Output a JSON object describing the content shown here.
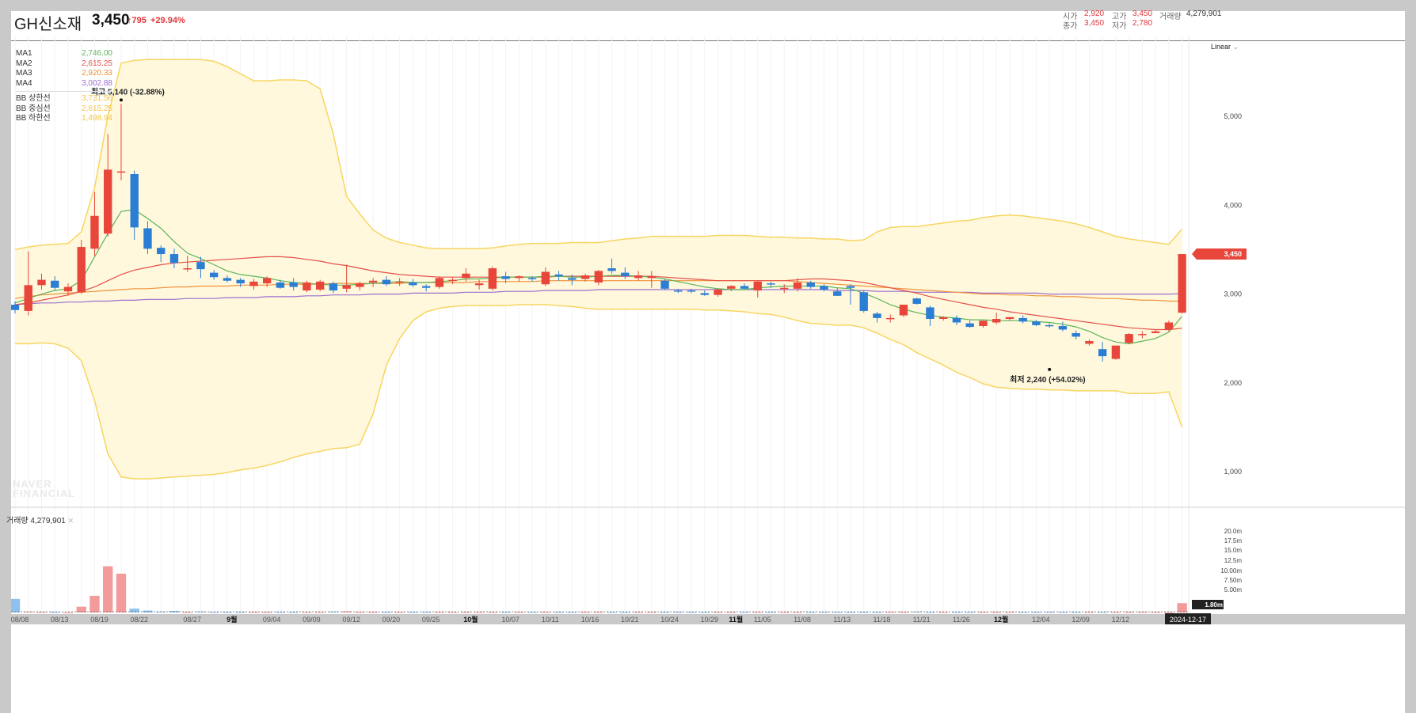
{
  "header": {
    "stock_name": "GH신소재",
    "price": "3,450",
    "change": "795",
    "change_rate": "+29.94%",
    "open_label": "시가",
    "open_value": "2,920",
    "high_label": "고가",
    "high_value": "3,450",
    "volume_label": "거래량",
    "volume_value": "4,279,901",
    "close_label": "종가",
    "close_value": "3,450",
    "low_label": "저가",
    "low_value": "2,780"
  },
  "legend": [
    {
      "label": "MA1",
      "value": "2,746.00",
      "color": "#5bb55b"
    },
    {
      "label": "MA2",
      "value": "2,615.25",
      "color": "#e4504a"
    },
    {
      "label": "MA3",
      "value": "2,920.33",
      "color": "#f0923a"
    },
    {
      "label": "MA4",
      "value": "3,002.88",
      "color": "#9b6fcf"
    },
    {
      "label": "BB 상한선",
      "value": "3,731.56",
      "color": "#f5c542"
    },
    {
      "label": "BB 중심선",
      "value": "2,615.25",
      "color": "#f5c542"
    },
    {
      "label": "BB 하한선",
      "value": "1,498.94",
      "color": "#f5c542"
    }
  ],
  "scale_mode": "Linear",
  "volume_panel_label": "거래량 4,279,901",
  "watermark": "NAVER FINANCIAL",
  "colors": {
    "up": "#e8463b",
    "down": "#2b7ed3",
    "band_fill": "#fff8dc",
    "band_line": "#f7d562",
    "price_tag": "#e8463b"
  },
  "chart_data": {
    "type": "candlestick",
    "x_ticks": [
      "08/08",
      "08/13",
      "08/19",
      "08/22",
      "08/27",
      "9월",
      "09/04",
      "09/09",
      "09/12",
      "09/20",
      "09/25",
      "10월",
      "10/07",
      "10/11",
      "10/16",
      "10/21",
      "10/24",
      "10/29",
      "11월",
      "11/05",
      "11/08",
      "11/13",
      "11/18",
      "11/21",
      "11/26",
      "12월",
      "12/04",
      "12/09",
      "12/12"
    ],
    "x_bold_ticks": [
      "9월",
      "10월",
      "11월",
      "12월"
    ],
    "current_date": "2024-12-17",
    "price_axis_ticks": [
      1000,
      2000,
      3000,
      4000,
      5000
    ],
    "price_axis_labels": [
      "1,000",
      "2,000",
      "3,000",
      "4,000",
      "5,000"
    ],
    "price_range": [
      600,
      5900
    ],
    "last_price_tag": "3,450",
    "volume_axis_labels": [
      "20.0m",
      "17.5m",
      "15.0m",
      "12.5m",
      "10.00m",
      "7.50m",
      "5.00m",
      "1.80m"
    ],
    "volume_range": [
      0,
      22000000
    ],
    "annotations": [
      {
        "text": "최고 5,140 (-32.88%)",
        "index": 8,
        "value": 5140
      },
      {
        "text": "최저 2,240 (+54.02%)",
        "index": 78,
        "value": 2240
      }
    ],
    "candles": [
      [
        2880,
        2920,
        2780,
        2820
      ],
      [
        2810,
        3480,
        2760,
        3100
      ],
      [
        3100,
        3230,
        3050,
        3160
      ],
      [
        3150,
        3200,
        3040,
        3070
      ],
      [
        3030,
        3120,
        2980,
        3080
      ],
      [
        3020,
        3610,
        3000,
        3530
      ],
      [
        3510,
        4150,
        3430,
        3880
      ],
      [
        3680,
        4800,
        3650,
        4400
      ],
      [
        4380,
        5140,
        4280,
        4380
      ],
      [
        4350,
        4390,
        3610,
        3750
      ],
      [
        3740,
        3820,
        3450,
        3510
      ],
      [
        3520,
        3550,
        3360,
        3450
      ],
      [
        3450,
        3510,
        3290,
        3350
      ],
      [
        3280,
        3430,
        3250,
        3290
      ],
      [
        3360,
        3420,
        3180,
        3280
      ],
      [
        3240,
        3270,
        3160,
        3190
      ],
      [
        3180,
        3210,
        3130,
        3150
      ],
      [
        3160,
        3180,
        3080,
        3120
      ],
      [
        3090,
        3170,
        3050,
        3140
      ],
      [
        3120,
        3200,
        3080,
        3180
      ],
      [
        3130,
        3160,
        3060,
        3070
      ],
      [
        3130,
        3180,
        3040,
        3080
      ],
      [
        3040,
        3150,
        3020,
        3130
      ],
      [
        3050,
        3160,
        3030,
        3140
      ],
      [
        3120,
        3140,
        3010,
        3040
      ],
      [
        3060,
        3330,
        3020,
        3100
      ],
      [
        3080,
        3140,
        3040,
        3120
      ],
      [
        3130,
        3180,
        3080,
        3150
      ],
      [
        3160,
        3200,
        3090,
        3110
      ],
      [
        3130,
        3180,
        3090,
        3140
      ],
      [
        3130,
        3170,
        3080,
        3100
      ],
      [
        3090,
        3110,
        3030,
        3070
      ],
      [
        3080,
        3200,
        3060,
        3180
      ],
      [
        3150,
        3190,
        3110,
        3160
      ],
      [
        3180,
        3290,
        3140,
        3230
      ],
      [
        3100,
        3160,
        3050,
        3120
      ],
      [
        3060,
        3310,
        3040,
        3290
      ],
      [
        3200,
        3250,
        3120,
        3170
      ],
      [
        3180,
        3210,
        3140,
        3200
      ],
      [
        3180,
        3200,
        3140,
        3170
      ],
      [
        3110,
        3300,
        3090,
        3250
      ],
      [
        3220,
        3260,
        3150,
        3200
      ],
      [
        3180,
        3220,
        3100,
        3160
      ],
      [
        3170,
        3230,
        3140,
        3210
      ],
      [
        3130,
        3270,
        3100,
        3260
      ],
      [
        3290,
        3400,
        3230,
        3260
      ],
      [
        3240,
        3300,
        3170,
        3200
      ],
      [
        3180,
        3260,
        3150,
        3210
      ],
      [
        3180,
        3260,
        3070,
        3200
      ],
      [
        3150,
        3170,
        3050,
        3060
      ],
      [
        3040,
        3060,
        3010,
        3030
      ],
      [
        3040,
        3060,
        3010,
        3030
      ],
      [
        3010,
        3040,
        2980,
        2990
      ],
      [
        2990,
        3060,
        2970,
        3050
      ],
      [
        3060,
        3100,
        3030,
        3090
      ],
      [
        3090,
        3120,
        3050,
        3060
      ],
      [
        3040,
        3150,
        2960,
        3140
      ],
      [
        3120,
        3140,
        3070,
        3110
      ],
      [
        3060,
        3110,
        3010,
        3070
      ],
      [
        3060,
        3180,
        3030,
        3130
      ],
      [
        3130,
        3150,
        3060,
        3080
      ],
      [
        3090,
        3110,
        3030,
        3050
      ],
      [
        3030,
        3070,
        2980,
        2980
      ],
      [
        3090,
        3110,
        2880,
        3070
      ],
      [
        3020,
        3040,
        2790,
        2810
      ],
      [
        2780,
        2800,
        2680,
        2730
      ],
      [
        2720,
        2770,
        2680,
        2730
      ],
      [
        2760,
        2880,
        2740,
        2880
      ],
      [
        2950,
        2960,
        2880,
        2890
      ],
      [
        2850,
        2870,
        2640,
        2720
      ],
      [
        2720,
        2750,
        2700,
        2740
      ],
      [
        2730,
        2760,
        2650,
        2680
      ],
      [
        2670,
        2700,
        2620,
        2630
      ],
      [
        2640,
        2700,
        2620,
        2700
      ],
      [
        2680,
        2790,
        2660,
        2720
      ],
      [
        2720,
        2740,
        2700,
        2740
      ],
      [
        2730,
        2760,
        2670,
        2690
      ],
      [
        2690,
        2710,
        2640,
        2650
      ],
      [
        2650,
        2670,
        2620,
        2640
      ],
      [
        2640,
        2690,
        2580,
        2600
      ],
      [
        2560,
        2590,
        2490,
        2520
      ],
      [
        2440,
        2490,
        2420,
        2470
      ],
      [
        2380,
        2460,
        2240,
        2300
      ],
      [
        2270,
        2420,
        2260,
        2420
      ],
      [
        2450,
        2560,
        2440,
        2550
      ],
      [
        2540,
        2580,
        2500,
        2550
      ],
      [
        2560,
        2600,
        2560,
        2580
      ],
      [
        2600,
        2700,
        2580,
        2680
      ],
      [
        2790,
        3450,
        2780,
        3450
      ]
    ],
    "volumes": [
      3.5,
      0.2,
      0.1,
      0.1,
      0.0,
      1.5,
      4.3,
      11.9,
      10.0,
      1.0,
      0.5,
      0.2,
      0.4,
      0.1,
      0.2,
      0.1,
      0.1,
      0.1,
      0.1,
      0.1,
      0.1,
      0.1,
      0.1,
      0.1,
      0.2,
      0.3,
      0.1,
      0.1,
      0.1,
      0.1,
      0.1,
      0.1,
      0.1,
      0.1,
      0.1,
      0.1,
      0.1,
      0.1,
      0.1,
      0.1,
      0.1,
      0.1,
      0.1,
      0.1,
      0.1,
      0.1,
      0.1,
      0.1,
      0.1,
      0.1,
      0.1,
      0.1,
      0.1,
      0.1,
      0.1,
      0.1,
      0.1,
      0.1,
      0.1,
      0.1,
      0.1,
      0.1,
      0.1,
      0.1,
      0.1,
      0.1,
      0.1,
      0.1,
      0.2,
      0.1,
      0.1,
      0.1,
      0.1,
      0.1,
      0.1,
      0.1,
      0.1,
      0.1,
      0.1,
      0.1,
      0.1,
      0.1,
      0.1,
      0.1,
      0.1,
      0.1,
      0.1,
      0.1,
      2.4
    ],
    "ma1": [
      2900,
      2950,
      3000,
      3040,
      3060,
      3150,
      3420,
      3680,
      3930,
      3950,
      3850,
      3740,
      3590,
      3460,
      3400,
      3330,
      3260,
      3220,
      3200,
      3180,
      3150,
      3130,
      3120,
      3110,
      3100,
      3100,
      3110,
      3120,
      3130,
      3140,
      3130,
      3130,
      3140,
      3150,
      3170,
      3170,
      3180,
      3190,
      3190,
      3190,
      3200,
      3200,
      3190,
      3190,
      3200,
      3210,
      3210,
      3200,
      3190,
      3170,
      3140,
      3110,
      3080,
      3060,
      3050,
      3050,
      3070,
      3080,
      3090,
      3090,
      3090,
      3090,
      3070,
      3060,
      3010,
      2950,
      2880,
      2830,
      2790,
      2760,
      2740,
      2730,
      2710,
      2710,
      2700,
      2700,
      2700,
      2690,
      2680,
      2660,
      2630,
      2580,
      2510,
      2460,
      2440,
      2470,
      2500,
      2570,
      2750
    ],
    "ma2": [
      2880,
      2900,
      2930,
      2960,
      2990,
      3030,
      3080,
      3150,
      3220,
      3270,
      3300,
      3330,
      3350,
      3360,
      3370,
      3380,
      3390,
      3400,
      3410,
      3420,
      3420,
      3410,
      3390,
      3370,
      3340,
      3320,
      3290,
      3260,
      3240,
      3220,
      3210,
      3200,
      3190,
      3190,
      3190,
      3190,
      3190,
      3190,
      3190,
      3190,
      3190,
      3200,
      3200,
      3200,
      3200,
      3200,
      3200,
      3200,
      3200,
      3190,
      3180,
      3170,
      3160,
      3150,
      3150,
      3150,
      3150,
      3150,
      3150,
      3160,
      3170,
      3170,
      3160,
      3150,
      3130,
      3100,
      3070,
      3040,
      3010,
      2970,
      2940,
      2910,
      2880,
      2850,
      2830,
      2800,
      2780,
      2760,
      2740,
      2720,
      2700,
      2680,
      2660,
      2640,
      2620,
      2610,
      2600,
      2600,
      2615
    ],
    "ma3": [
      2950,
      2970,
      2990,
      3000,
      3010,
      3020,
      3030,
      3040,
      3050,
      3060,
      3060,
      3070,
      3080,
      3080,
      3090,
      3090,
      3090,
      3100,
      3100,
      3100,
      3110,
      3110,
      3110,
      3110,
      3120,
      3120,
      3120,
      3120,
      3120,
      3120,
      3130,
      3130,
      3130,
      3130,
      3130,
      3140,
      3140,
      3140,
      3140,
      3140,
      3150,
      3150,
      3150,
      3150,
      3150,
      3150,
      3150,
      3150,
      3150,
      3150,
      3150,
      3150,
      3150,
      3150,
      3150,
      3150,
      3150,
      3150,
      3150,
      3140,
      3130,
      3120,
      3110,
      3100,
      3090,
      3080,
      3070,
      3060,
      3050,
      3040,
      3030,
      3020,
      3010,
      3000,
      3000,
      2990,
      2990,
      2980,
      2980,
      2970,
      2970,
      2960,
      2950,
      2950,
      2940,
      2930,
      2930,
      2920,
      2920
    ],
    "ma4": [
      2880,
      2890,
      2900,
      2900,
      2910,
      2910,
      2920,
      2920,
      2930,
      2930,
      2940,
      2940,
      2940,
      2950,
      2950,
      2950,
      2960,
      2960,
      2960,
      2970,
      2970,
      2970,
      2980,
      2980,
      2990,
      2990,
      2990,
      3000,
      3000,
      3000,
      3010,
      3010,
      3010,
      3010,
      3020,
      3020,
      3020,
      3030,
      3030,
      3030,
      3040,
      3040,
      3040,
      3040,
      3050,
      3050,
      3050,
      3050,
      3050,
      3050,
      3050,
      3050,
      3050,
      3050,
      3050,
      3050,
      3050,
      3050,
      3050,
      3050,
      3050,
      3050,
      3040,
      3040,
      3040,
      3030,
      3030,
      3030,
      3020,
      3020,
      3020,
      3020,
      3020,
      3010,
      3010,
      3010,
      3010,
      3010,
      3000,
      3000,
      3000,
      3000,
      3000,
      3000,
      3000,
      3000,
      3000,
      3000,
      3003
    ],
    "bb_upper": [
      3500,
      3530,
      3550,
      3560,
      3570,
      3700,
      4200,
      5000,
      5600,
      5630,
      5640,
      5640,
      5640,
      5640,
      5640,
      5620,
      5560,
      5480,
      5400,
      5400,
      5410,
      5410,
      5400,
      5310,
      4800,
      4100,
      3900,
      3720,
      3630,
      3580,
      3550,
      3520,
      3510,
      3510,
      3510,
      3510,
      3520,
      3540,
      3560,
      3570,
      3570,
      3570,
      3580,
      3580,
      3580,
      3600,
      3620,
      3630,
      3650,
      3650,
      3650,
      3650,
      3650,
      3660,
      3660,
      3660,
      3650,
      3640,
      3640,
      3630,
      3630,
      3620,
      3620,
      3600,
      3610,
      3700,
      3750,
      3760,
      3760,
      3780,
      3800,
      3820,
      3830,
      3860,
      3880,
      3890,
      3880,
      3860,
      3840,
      3820,
      3790,
      3750,
      3700,
      3650,
      3620,
      3600,
      3580,
      3560,
      3731
    ],
    "bb_lower": [
      2440,
      2440,
      2450,
      2440,
      2390,
      2250,
      1800,
      1200,
      940,
      920,
      920,
      930,
      940,
      950,
      960,
      970,
      990,
      1020,
      1040,
      1070,
      1110,
      1160,
      1200,
      1230,
      1260,
      1270,
      1310,
      1650,
      2200,
      2500,
      2700,
      2800,
      2840,
      2860,
      2870,
      2870,
      2870,
      2870,
      2880,
      2880,
      2880,
      2870,
      2860,
      2840,
      2830,
      2830,
      2830,
      2830,
      2830,
      2830,
      2830,
      2830,
      2820,
      2820,
      2810,
      2800,
      2780,
      2770,
      2740,
      2700,
      2670,
      2660,
      2650,
      2650,
      2620,
      2560,
      2490,
      2430,
      2340,
      2270,
      2200,
      2120,
      2060,
      1990,
      1950,
      1940,
      1930,
      1930,
      1920,
      1920,
      1910,
      1910,
      1910,
      1910,
      1880,
      1880,
      1880,
      1900,
      1499
    ]
  }
}
